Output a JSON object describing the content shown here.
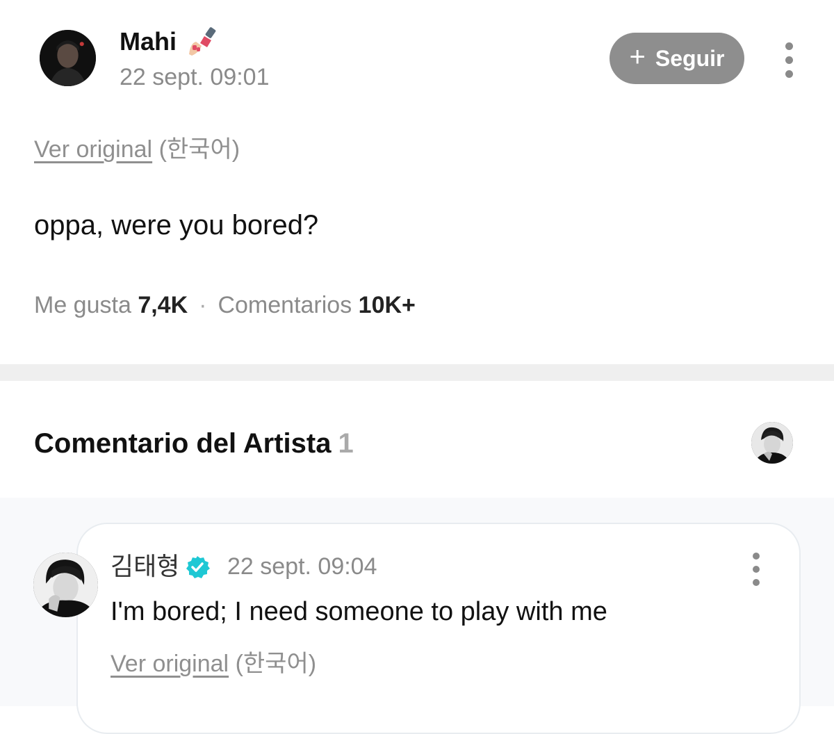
{
  "post": {
    "author_name": "Mahi",
    "author_emoji_icon": "nail-polish-icon",
    "timestamp": "22 sept. 09:01",
    "follow_label": "Seguir",
    "translate_link": "Ver original",
    "translate_lang": "(한국어)",
    "text": "oppa, were you bored?",
    "likes_label": "Me gusta",
    "likes_count": "7,4K",
    "separator": "·",
    "comments_label": "Comentarios",
    "comments_count": "10K+"
  },
  "artist_comments": {
    "title": "Comentario del Artista",
    "count": "1",
    "comment": {
      "author_name": "김태형",
      "verified_icon": "verified-badge-icon",
      "timestamp": "22 sept. 09:04",
      "text": "I'm bored; I need someone to play with me",
      "translate_link": "Ver original",
      "translate_lang": "(한국어)"
    }
  },
  "colors": {
    "follow_button": "#8e8e8e",
    "verified": "#1ec8d4",
    "muted_text": "#8a8a8a",
    "divider": "#efefef"
  }
}
